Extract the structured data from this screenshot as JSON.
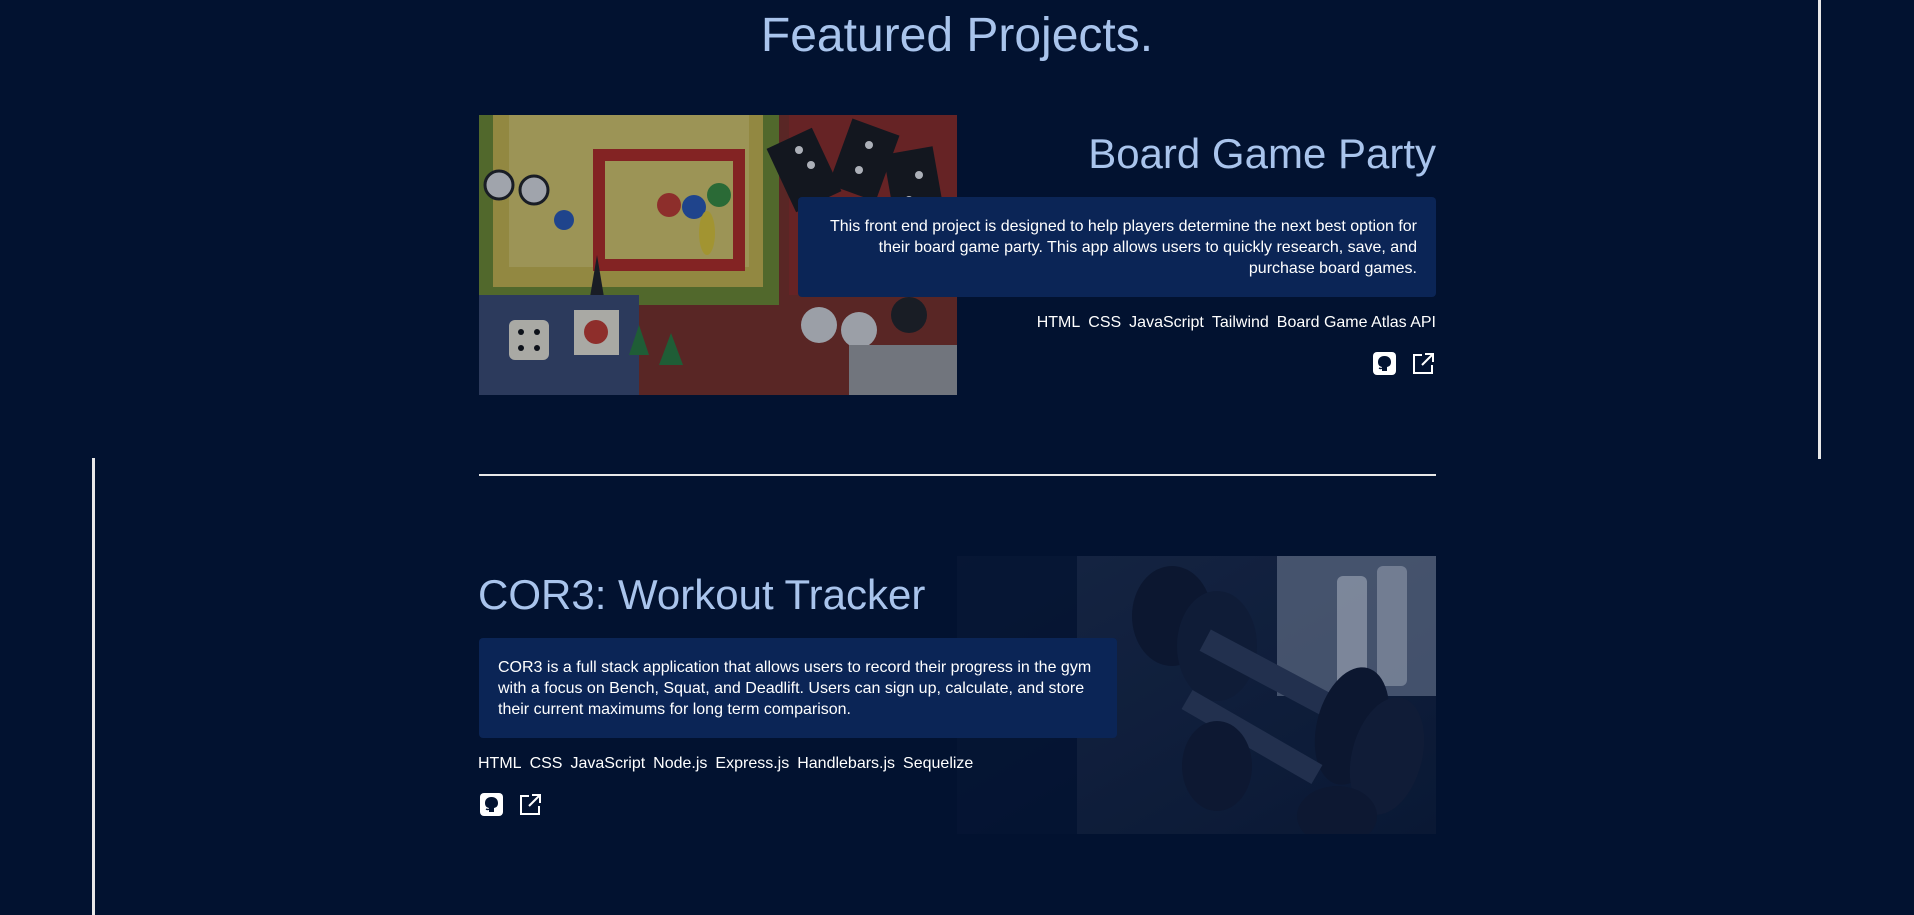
{
  "section": {
    "title": "Featured Projects."
  },
  "projects": [
    {
      "title": "Board Game Party",
      "description": "This front end project is designed to help players determine the next best option for their board game party. This app allows users to quickly research, save, and purchase board games.",
      "tags": [
        "HTML",
        "CSS",
        "JavaScript",
        "Tailwind",
        "Board Game Atlas API"
      ],
      "links": [
        "github-icon",
        "external-link-icon"
      ]
    },
    {
      "title": "COR3: Workout Tracker",
      "description": "COR3 is a full stack application that allows users to record their progress in the gym with a focus on Bench, Squat, and Deadlift. Users can sign up, calculate, and store their current maximums for long term comparison.",
      "tags": [
        "HTML",
        "CSS",
        "JavaScript",
        "Node.js",
        "Express.js",
        "Handlebars.js",
        "Sequelize"
      ],
      "links": [
        "github-icon",
        "external-link-icon"
      ]
    }
  ],
  "colors": {
    "background": "#021230",
    "title": "#a9c4ec",
    "description_bg": "#0b2556",
    "text": "#ffffff",
    "rule": "#e8e8e8"
  }
}
